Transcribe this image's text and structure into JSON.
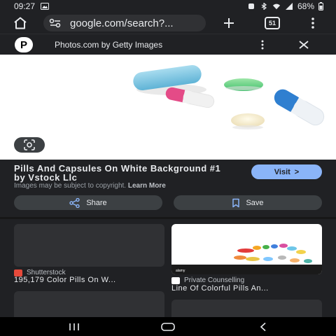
{
  "status": {
    "time": "09:27",
    "battery": "68%"
  },
  "browser": {
    "url": "google.com/search?...",
    "tab_count": "51"
  },
  "source": {
    "logo_letter": "P",
    "name": "Photos.com by Getty Images"
  },
  "result": {
    "title": "Pills And Capsules On White Background #1 by Vstock Llc",
    "copyright_prefix": "Images may be subject to copyright.",
    "learn_more": "Learn More",
    "visit_label": "Visit",
    "visit_arrow": ">",
    "share_label": "Share",
    "save_label": "Save"
  },
  "related": [
    {
      "source": "Shutterstock",
      "title": "195,179 Color Pills On W..."
    },
    {
      "source": "Private Counselling",
      "title": "Line Of Colorful Pills An..."
    }
  ],
  "colors": {
    "accent": "#8ab4f8",
    "background": "#202124",
    "shutterstock": "#e64a3b"
  }
}
